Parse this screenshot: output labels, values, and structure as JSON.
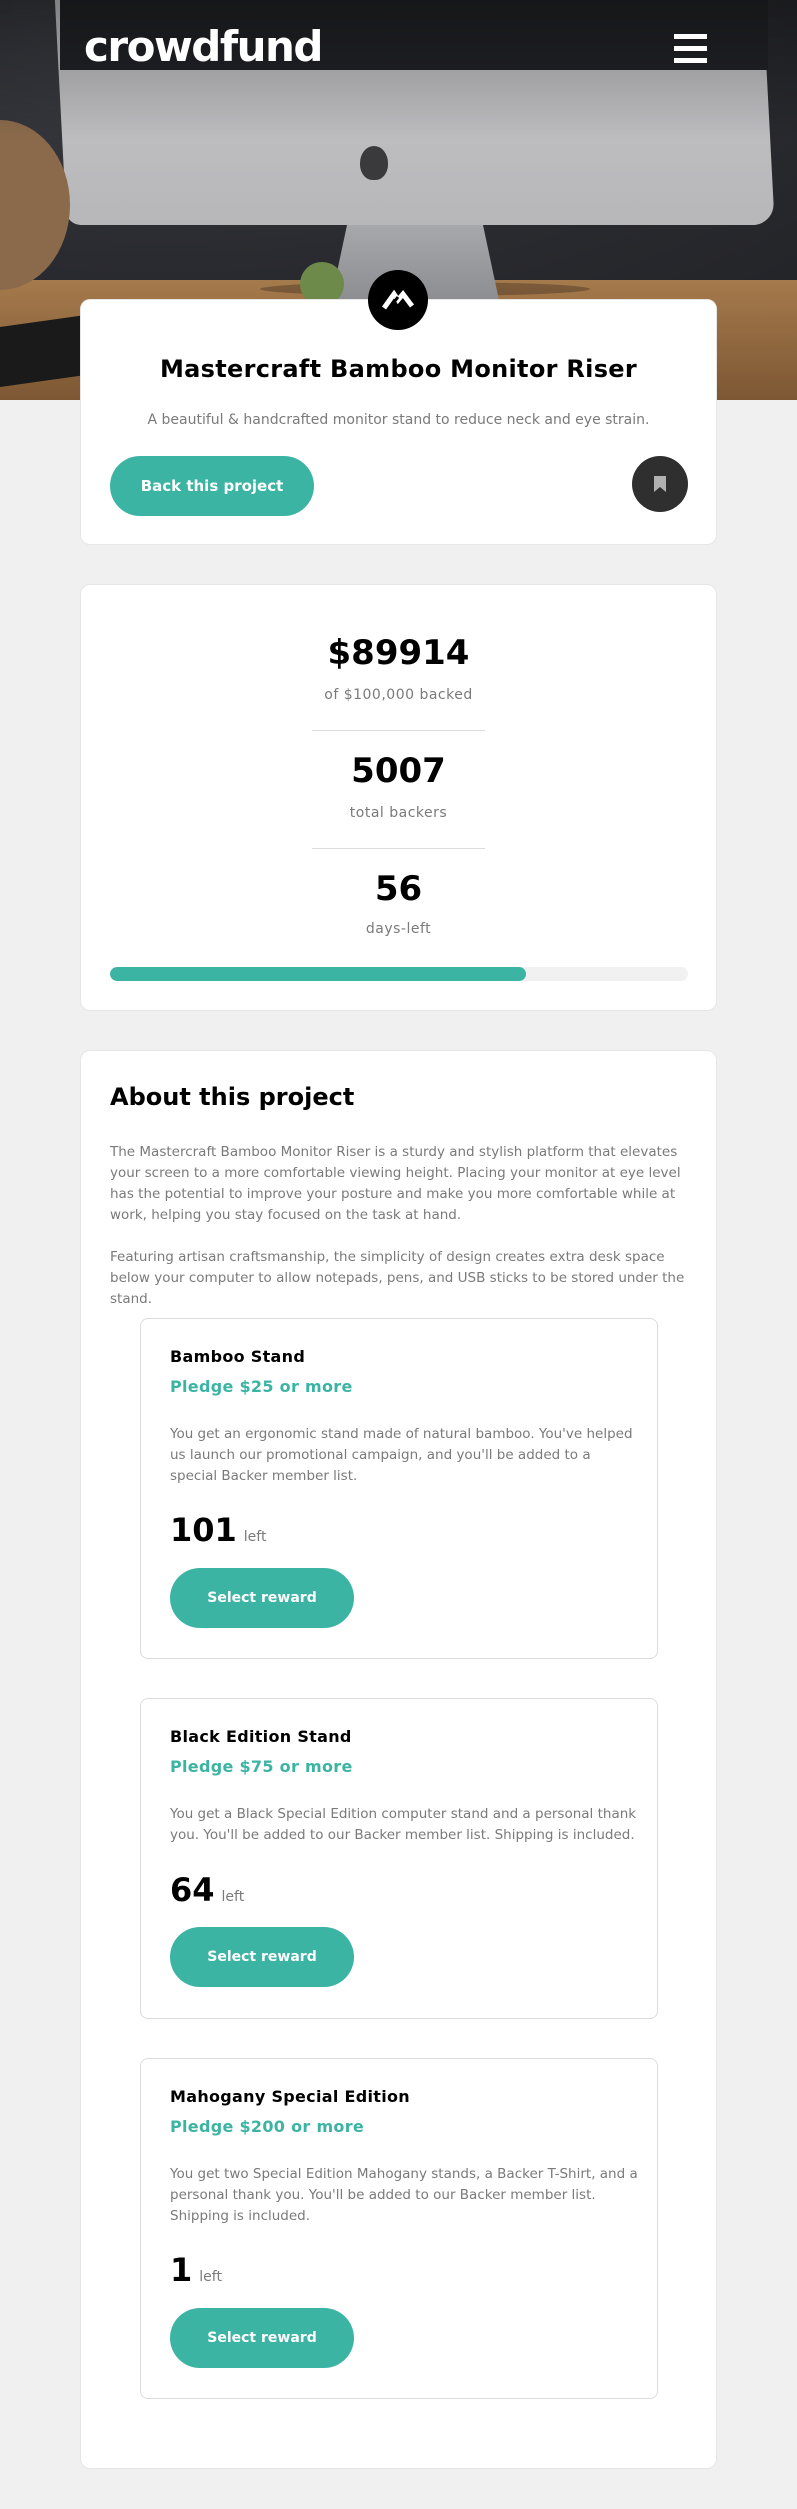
{
  "header": {
    "brand": "crowdfund",
    "menu_icon": "hamburger-icon"
  },
  "intro": {
    "logo_icon": "mastercraft-logo-icon",
    "title": "Mastercraft Bamboo Monitor Riser",
    "description": "A beautiful & handcrafted monitor stand to reduce neck and eye strain.",
    "back_button_label": "Back this project",
    "bookmark_icon": "bookmark-icon"
  },
  "stats": {
    "backed_amount": "$89914",
    "backed_label": "of $100,000 backed",
    "backers_value": "5007",
    "backers_label": "total backers",
    "days_value": "56",
    "days_label": "days-left",
    "progress_fraction": 0.72,
    "progress_color": "#3cb4a4"
  },
  "about": {
    "title": "About this project",
    "paragraph1": "The Mastercraft Bamboo Monitor Riser is a sturdy and stylish platform that elevates your screen to a more comfortable viewing height. Placing your monitor at eye level has the potential to improve your posture and make you more comfortable while at work, helping you stay focused on the task at hand.",
    "paragraph2": "Featuring artisan craftsmanship, the simplicity of design creates extra desk space below your computer to allow notepads, pens, and USB sticks to be stored under the stand."
  },
  "rewards": [
    {
      "name": "Bamboo Stand",
      "pledge": "Pledge $25 or more",
      "description": "You get an ergonomic stand made of natural bamboo. You've helped us launch our promotional campaign, and you'll be added to a special Backer member list.",
      "count": "101",
      "left_label": "left",
      "button_label": "Select reward"
    },
    {
      "name": "Black Edition Stand",
      "pledge": "Pledge $75 or more",
      "description": "You get a Black Special Edition computer stand and a personal thank you. You'll be added to our Backer member list. Shipping is included.",
      "count": "64",
      "left_label": "left",
      "button_label": "Select reward"
    },
    {
      "name": "Mahogany Special Edition",
      "pledge": "Pledge $200 or more",
      "description": "You get two Special Edition Mahogany stands, a Backer T-Shirt, and a personal thank you. You'll be added to our Backer member list. Shipping is included.",
      "count": "1",
      "left_label": "left",
      "button_label": "Select reward"
    }
  ],
  "colors": {
    "accent": "#3cb4a4",
    "background": "#f0f0f0"
  }
}
